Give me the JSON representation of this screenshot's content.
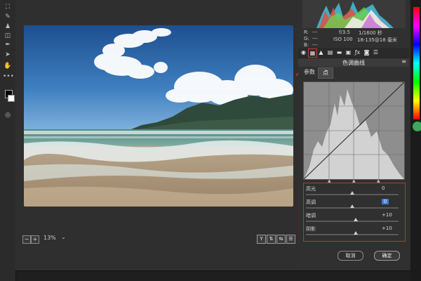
{
  "toolbar": {
    "tools": [
      "crop",
      "eyedropper",
      "brush",
      "eraser",
      "pen",
      "gradient",
      "hand",
      "more"
    ]
  },
  "dialog": {
    "zoom": "13%",
    "view_buttons": [
      "Y",
      "swap",
      "arrows",
      "settings"
    ]
  },
  "metadata": {
    "r_label": "R:",
    "g_label": "G:",
    "b_label": "B:",
    "r_value": "---",
    "g_value": "---",
    "b_value": "---",
    "aperture": "f/3.5",
    "shutter": "1/1600 秒",
    "iso": "ISO 100",
    "lens": "18-135@18 毫米"
  },
  "panel": {
    "title": "色调曲线",
    "tabs": [
      "参数",
      "点"
    ],
    "active_tab": "点",
    "sliders": [
      {
        "label": "高光",
        "value": "0",
        "level": 0.5,
        "highlight": false
      },
      {
        "label": "高调",
        "value": "0",
        "level": 0.5,
        "highlight": true
      },
      {
        "label": "暗调",
        "value": "+10",
        "level": 0.535,
        "highlight": false
      },
      {
        "label": "阴影",
        "value": "+10",
        "level": 0.535,
        "highlight": false
      }
    ]
  },
  "buttons": {
    "cancel": "取消",
    "ok": "确定"
  },
  "colors": {
    "dialog_bg": "#2f2f2f",
    "highlight_border": "#b23a3a",
    "annotation_arrow": "#cc3b3b",
    "selected_value": "#3a7bd5"
  }
}
